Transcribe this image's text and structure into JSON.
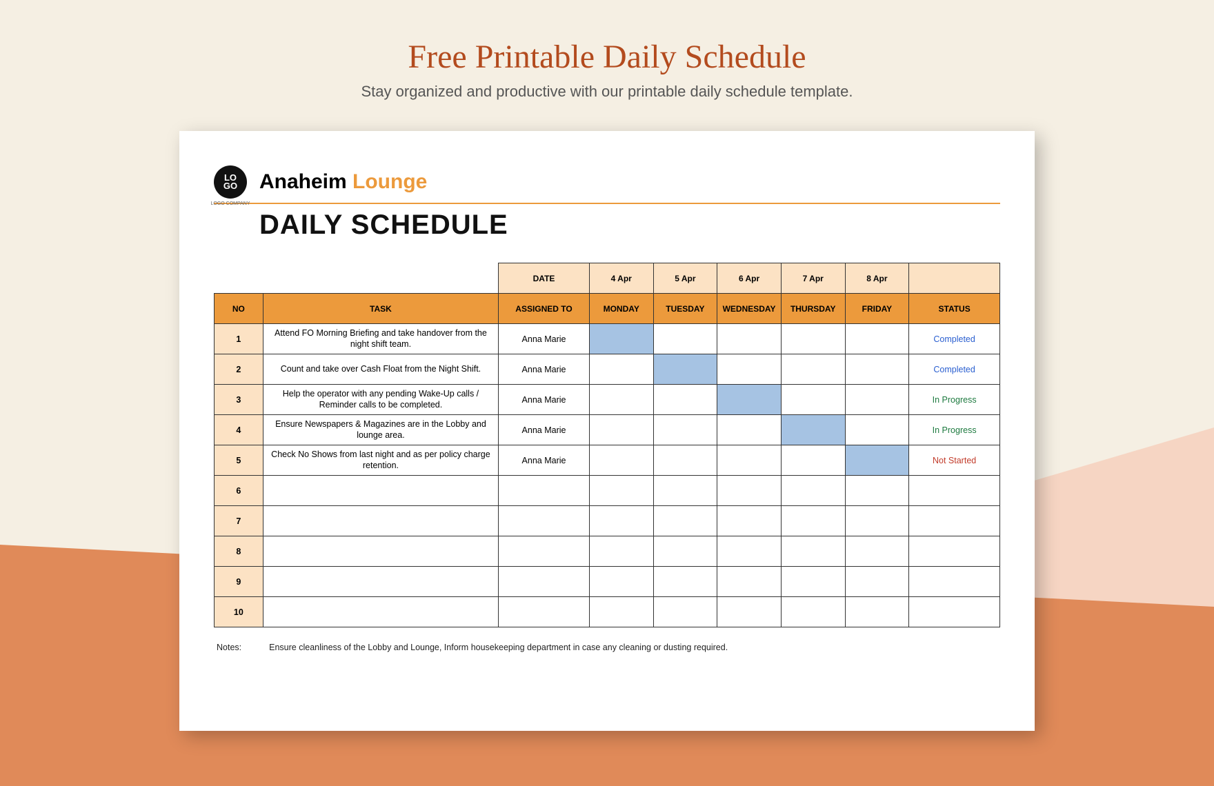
{
  "page": {
    "title": "Free Printable Daily Schedule",
    "subtitle": "Stay organized and productive with our printable daily schedule template."
  },
  "logo": {
    "line1": "LO",
    "line2": "GO",
    "sub": "LOGO COMPANY"
  },
  "brand": {
    "part1": "Anaheim ",
    "part2": "Lounge"
  },
  "doc_title": "DAILY SCHEDULE",
  "table": {
    "date_label": "DATE",
    "dates": [
      "4 Apr",
      "5 Apr",
      "6 Apr",
      "7 Apr",
      "8 Apr"
    ],
    "headers": {
      "no": "NO",
      "task": "TASK",
      "assigned": "ASSIGNED TO",
      "days": [
        "MONDAY",
        "TUESDAY",
        "WEDNESDAY",
        "THURSDAY",
        "FRIDAY"
      ],
      "status": "STATUS"
    },
    "rows": [
      {
        "no": "1",
        "task": "Attend FO Morning Briefing and take handover from the night shift team.",
        "assigned": "Anna Marie",
        "fill": [
          true,
          false,
          false,
          false,
          false
        ],
        "status": "Completed",
        "status_class": "completed"
      },
      {
        "no": "2",
        "task": "Count and take over Cash Float from the Night Shift.",
        "assigned": "Anna Marie",
        "fill": [
          false,
          true,
          false,
          false,
          false
        ],
        "status": "Completed",
        "status_class": "completed"
      },
      {
        "no": "3",
        "task": "Help the operator with any pending Wake-Up calls / Reminder calls to be completed.",
        "assigned": "Anna Marie",
        "fill": [
          false,
          false,
          true,
          false,
          false
        ],
        "status": "In Progress",
        "status_class": "inprogress"
      },
      {
        "no": "4",
        "task": "Ensure Newspapers & Magazines are in the Lobby and lounge area.",
        "assigned": "Anna Marie",
        "fill": [
          false,
          false,
          false,
          true,
          false
        ],
        "status": "In Progress",
        "status_class": "inprogress"
      },
      {
        "no": "5",
        "task": "Check No Shows from last night and as per policy charge retention.",
        "assigned": "Anna Marie",
        "fill": [
          false,
          false,
          false,
          false,
          true
        ],
        "status": "Not Started",
        "status_class": "notstarted"
      },
      {
        "no": "6",
        "task": "",
        "assigned": "",
        "fill": [
          false,
          false,
          false,
          false,
          false
        ],
        "status": "",
        "status_class": ""
      },
      {
        "no": "7",
        "task": "",
        "assigned": "",
        "fill": [
          false,
          false,
          false,
          false,
          false
        ],
        "status": "",
        "status_class": ""
      },
      {
        "no": "8",
        "task": "",
        "assigned": "",
        "fill": [
          false,
          false,
          false,
          false,
          false
        ],
        "status": "",
        "status_class": ""
      },
      {
        "no": "9",
        "task": "",
        "assigned": "",
        "fill": [
          false,
          false,
          false,
          false,
          false
        ],
        "status": "",
        "status_class": ""
      },
      {
        "no": "10",
        "task": "",
        "assigned": "",
        "fill": [
          false,
          false,
          false,
          false,
          false
        ],
        "status": "",
        "status_class": ""
      }
    ]
  },
  "notes": {
    "label": "Notes:",
    "text": "Ensure cleanliness of the Lobby and Lounge, Inform housekeeping department in case any cleaning or dusting required."
  }
}
